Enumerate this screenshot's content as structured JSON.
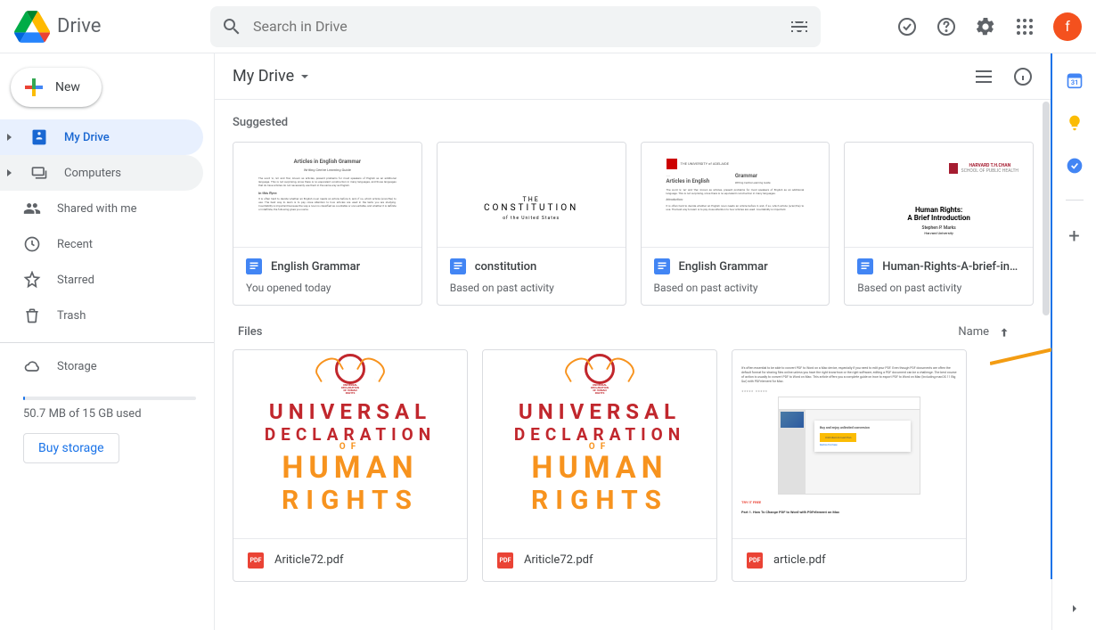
{
  "app": {
    "name": "Drive"
  },
  "search": {
    "placeholder": "Search in Drive"
  },
  "avatar": {
    "initial": "f"
  },
  "sidebar": {
    "new_label": "New",
    "items": [
      {
        "label": "My Drive"
      },
      {
        "label": "Computers"
      },
      {
        "label": "Shared with me"
      },
      {
        "label": "Recent"
      },
      {
        "label": "Starred"
      },
      {
        "label": "Trash"
      }
    ],
    "storage_label": "Storage",
    "storage_used": "50.7 MB of 15 GB used",
    "buy_label": "Buy storage"
  },
  "content": {
    "breadcrumb": "My Drive",
    "suggested_label": "Suggested",
    "files_label": "Files",
    "sort_label": "Name"
  },
  "suggested": [
    {
      "title": "English Grammar",
      "subtitle": "You opened today",
      "preview_heading": "Articles in English Grammar",
      "preview_sub": "Writing Centre Learning Guide"
    },
    {
      "title": "constitution",
      "subtitle": "Based on past activity",
      "preview_small": "THE",
      "preview_large": "CONSTITUTION",
      "preview_below": "of the United States"
    },
    {
      "title": "English Grammar",
      "subtitle": "Based on past activity",
      "preview_heading": "Articles in English",
      "preview_heading2": "Grammar",
      "preview_sub": "Writing Centre Learning Guide"
    },
    {
      "title": "Human-Rights-A-brief-in…",
      "subtitle": "Based on past activity",
      "preview_brand": "HARVARD T.H.CHAN",
      "preview_school": "SCHOOL OF PUBLIC HEALTH",
      "preview_title": "Human Rights:",
      "preview_title2": "A Brief Introduction",
      "preview_author": "Stephen P. Marks",
      "preview_uni": "Harvard University"
    }
  ],
  "files": [
    {
      "name": "Ariticle72.pdf",
      "type": "pdf",
      "preview": "udhr"
    },
    {
      "name": "Ariticle72.pdf",
      "type": "pdf",
      "preview": "udhr"
    },
    {
      "name": "article.pdf",
      "type": "pdf",
      "preview": "article"
    }
  ],
  "udhr": {
    "l1": "UNIVERSAL",
    "l2": "DECLARATION",
    "of": "OF",
    "l3": "HUMAN",
    "l4": "RIGHTS"
  },
  "article": {
    "txt": "It's often essential to be able to convert PDF to Word on a Mac device, especially if you need to edit your PDF. Even though PDF documents are often the default format for sharing files online unless you have the right know-how or the right software, editing a PDF document can be a challenge. The best course of action is usually to convert PDF to Word on Mac. This article offers you a complete guide on how to export PDF to Word on Mac (including macOS 11 Big Sur) with PDFelement for Mac.",
    "modal_title": "Buy and enjoy unlimited conversion",
    "footer": "Part 1. How To Change PDF to Word with PDFelement on Mac"
  }
}
